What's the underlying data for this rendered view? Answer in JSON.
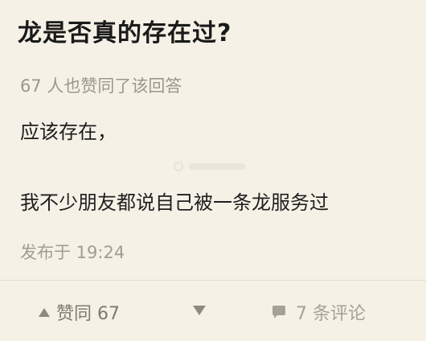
{
  "question": {
    "title": "龙是否真的存在过?"
  },
  "answer": {
    "likes_line": "67 人也赞同了该回答",
    "text_lines": [
      "应该存在，",
      "我不少朋友都说自己被一条龙服务过"
    ],
    "published": "发布于 19:24"
  },
  "actions": {
    "upvote_label": "赞同 67",
    "comments_label": "7 条评论",
    "upvote_icon": "upvote-triangle-icon",
    "downvote_icon": "downvote-triangle-icon",
    "comment_icon": "comment-bubble-icon"
  },
  "colors": {
    "background": "#f5f1e6",
    "title": "#1a1a1a",
    "muted": "#9a978f"
  }
}
